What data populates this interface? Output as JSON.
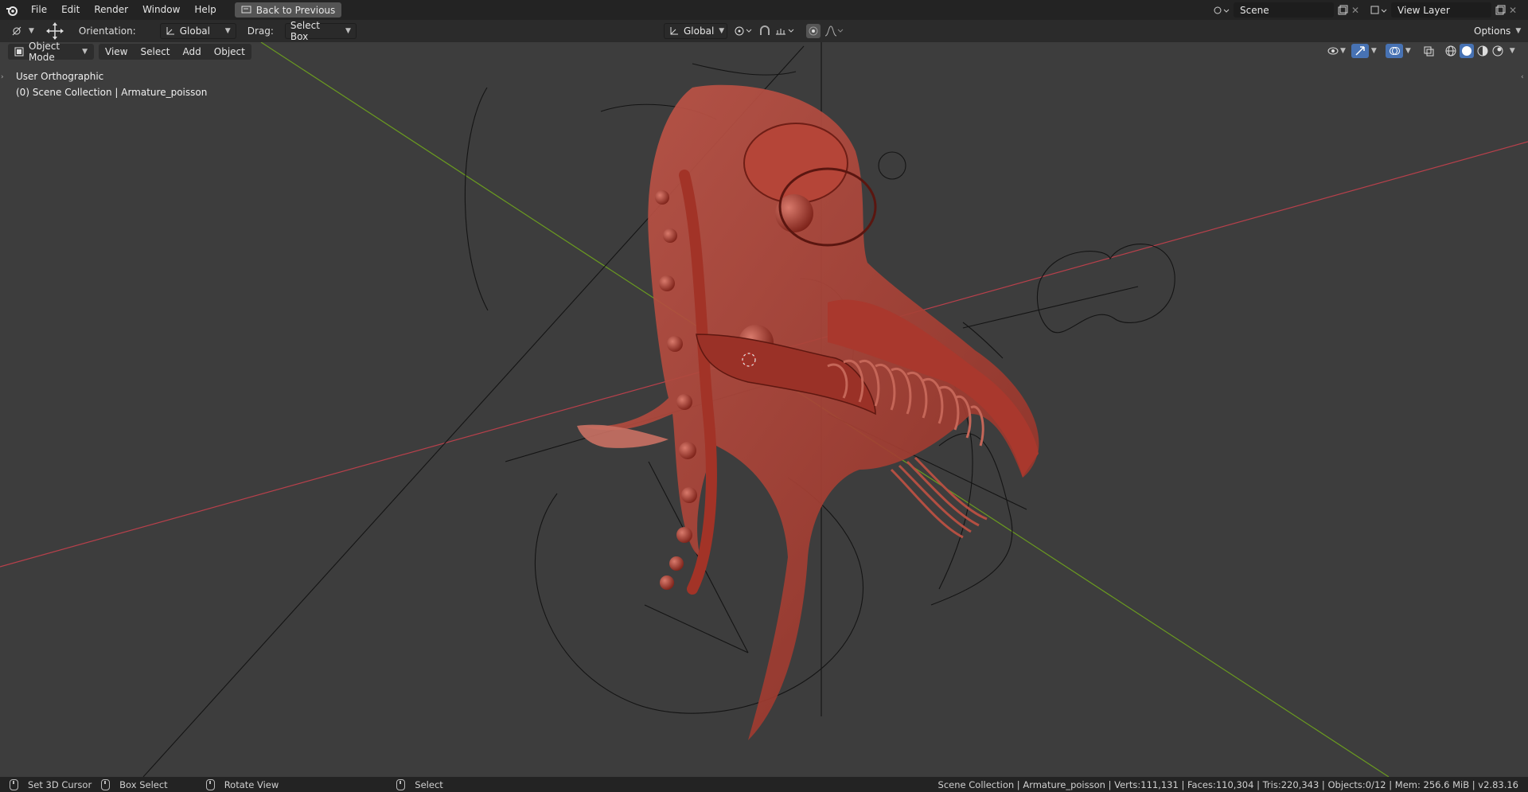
{
  "topbar": {
    "menus": [
      "File",
      "Edit",
      "Render",
      "Window",
      "Help"
    ],
    "back_button": "Back to Previous",
    "scene_name": "Scene",
    "view_layer_name": "View Layer"
  },
  "toolbar": {
    "orientation_label": "Orientation:",
    "orientation_value": "Global",
    "drag_label": "Drag:",
    "drag_value": "Select Box",
    "transform_orientation": "Global",
    "options_label": "Options"
  },
  "viewport_header": {
    "mode": "Object Mode",
    "menus": [
      "View",
      "Select",
      "Add",
      "Object"
    ]
  },
  "viewport": {
    "view_name": "User Orthographic",
    "collection_info": "(0) Scene Collection | Armature_poisson",
    "colors": {
      "x_axis": "#c0414f",
      "y_axis": "#6d9a1f",
      "mesh": "#b5473c"
    }
  },
  "statusbar": {
    "hints": [
      {
        "icon": "mouse-left-icon",
        "label": "Set 3D Cursor"
      },
      {
        "icon": "mouse-middle-icon",
        "label": "Box Select"
      },
      {
        "icon": "mouse-right-icon",
        "label": "Rotate View"
      },
      {
        "icon": "mouse-left-icon",
        "label": "Select"
      }
    ],
    "stats": "Scene Collection | Armature_poisson | Verts:111,131 | Faces:110,304 | Tris:220,343 | Objects:0/12 | Mem: 256.6 MiB | v2.83.16"
  }
}
